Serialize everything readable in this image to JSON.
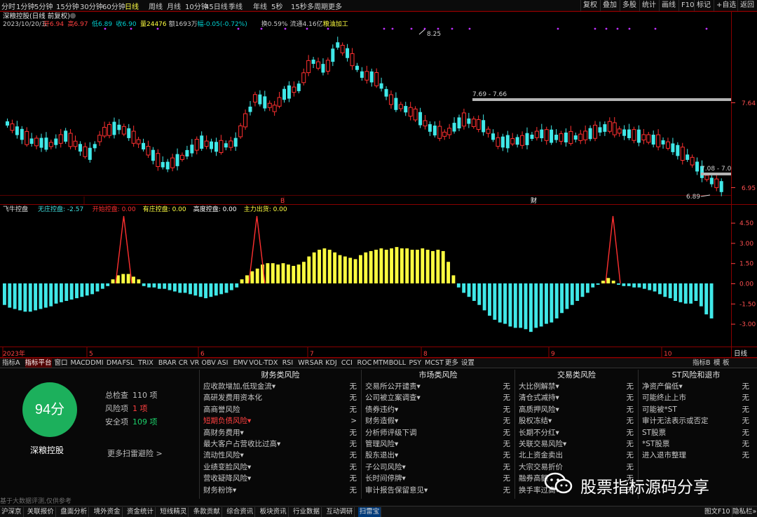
{
  "toolbar": {
    "periods": [
      "分时",
      "1分钟",
      "5分钟",
      "15分钟",
      "30分钟",
      "60分钟",
      "日线",
      "周线",
      "月线",
      "10分钟",
      "45日线",
      "季线",
      "年线",
      "5秒",
      "15秒",
      "多周期",
      "更多"
    ],
    "active_period": "日线",
    "tools": [
      "复权",
      "叠加",
      "多股",
      "统计",
      "画线",
      "F10",
      "标记",
      "+自选",
      "返回"
    ]
  },
  "header": {
    "stock": "深粮控股(日线 前复权)",
    "date": "2023/10/20/五",
    "quote": [
      {
        "label": "开",
        "value": "6.94",
        "color": "#ff4040"
      },
      {
        "label": "高",
        "value": "6.97",
        "color": "#ff4040"
      },
      {
        "label": "低",
        "value": "6.89",
        "color": "#00d0d0"
      },
      {
        "label": "收",
        "value": "6.90",
        "color": "#00d0d0"
      },
      {
        "label": "量",
        "value": "24476",
        "color": "#ffff40"
      },
      {
        "label": "额",
        "value": "1693万",
        "color": "#c8c8c8"
      },
      {
        "label": "幅",
        "value": "-0.05(-0.72%)",
        "color": "#00d0d0"
      },
      {
        "label": "换",
        "value": "0.59%",
        "color": "#c8c8c8"
      },
      {
        "label": "流通",
        "value": "4.16亿",
        "color": "#c8c8c8"
      },
      {
        "label": "",
        "value": "粮油加工",
        "color": "#ffff40"
      }
    ]
  },
  "main_chart": {
    "price_ticks": [
      "7.64",
      "6.95"
    ],
    "annotations": {
      "high": "8.25",
      "resistance": "7.69 - 7.66",
      "support": "7.08 - 7.0",
      "low": "6.89"
    },
    "markers": [
      "B",
      "财"
    ]
  },
  "indicator": {
    "name": "飞牛控盘",
    "items": [
      {
        "label": "无庄控盘",
        "value": "-2.57",
        "color": "#40e0e0"
      },
      {
        "label": "开始控盘",
        "value": "0.00",
        "color": "#ff3030"
      },
      {
        "label": "有庄控盘",
        "value": "0.00",
        "color": "#ffff40"
      },
      {
        "label": "高度控盘",
        "value": "0.00",
        "color": "#ffffff"
      },
      {
        "label": "主力出货",
        "value": "0.00",
        "color": "#ffff40"
      }
    ],
    "ticks": [
      "4.50",
      "3.00",
      "1.50",
      "0.00",
      "-1.50",
      "-3.00"
    ],
    "months": [
      "2023年",
      "5",
      "6",
      "7",
      "8",
      "9",
      "10"
    ],
    "axis_label": "日线"
  },
  "chart_data": {
    "type": "bar",
    "title": "飞牛控盘",
    "ylim": [
      -3.8,
      5.2
    ],
    "x": [
      "2023-04",
      "2023-05",
      "2023-06",
      "2023-07",
      "2023-08",
      "2023-09",
      "2023-10"
    ],
    "values": [
      -1.6,
      -1.8,
      -1.9,
      -2.0,
      -2.1,
      -2.1,
      -2.0,
      -1.9,
      -1.8,
      -1.7,
      -1.5,
      -1.4,
      -1.3,
      -1.2,
      -1.1,
      -1.0,
      -0.9,
      -0.8,
      -0.6,
      -0.4,
      -0.2,
      0.3,
      0.6,
      0.7,
      0.7,
      0.5,
      0.3,
      -0.2,
      -0.3,
      -0.3,
      -0.4,
      -0.4,
      -0.5,
      -0.6,
      -0.7,
      -0.7,
      -0.8,
      -0.9,
      -1.0,
      -1.1,
      -1.0,
      -0.9,
      -0.8,
      -0.7,
      -0.5,
      -0.3,
      0.3,
      0.6,
      0.9,
      1.1,
      1.4,
      1.5,
      1.5,
      1.4,
      1.5,
      1.4,
      1.3,
      1.4,
      1.6,
      2.0,
      2.3,
      2.5,
      2.6,
      2.5,
      2.3,
      2.1,
      2.0,
      1.9,
      1.8,
      2.1,
      2.3,
      2.4,
      2.5,
      2.6,
      2.5,
      2.6,
      2.7,
      2.6,
      2.6,
      2.5,
      2.5,
      2.6,
      2.5,
      2.4,
      2.5,
      2.4,
      1.6,
      0.6,
      -0.3,
      -0.7,
      -1.0,
      -1.3,
      -1.6,
      -2.0,
      -2.4,
      -2.7,
      -2.9,
      -3.0,
      -3.2,
      -3.3,
      -3.3,
      -3.4,
      -3.6,
      -3.3,
      -3.2,
      -3.0,
      -2.9,
      -2.6,
      -2.2,
      -1.9,
      -1.6,
      -1.3,
      -1.0,
      -0.7,
      -0.3,
      -0.1,
      0.2,
      0.4,
      0.2,
      -0.1,
      -0.2,
      -0.2,
      -0.3,
      -0.3,
      -0.4,
      -0.5,
      -0.6,
      -0.8,
      -1.0,
      -1.1,
      -1.3,
      -1.4,
      -1.5,
      -1.5,
      -1.3,
      -1.7,
      -2.3,
      -2.6
    ]
  },
  "tabs": {
    "items": [
      "指标A",
      "指标平台",
      "窗口",
      "MACD",
      "DMI",
      "DMA",
      "FSL",
      "TRIX",
      "BRAR",
      "CR",
      "VR",
      "OBV",
      "ASI",
      "EMV",
      "VOL-TDX",
      "RSI",
      "WR",
      "SAR",
      "KDJ",
      "CCI",
      "ROC",
      "MTM",
      "BOLL",
      "PSY",
      "MCST",
      "更多",
      "设置"
    ],
    "active": "指标平台",
    "right": [
      "指标B",
      "模",
      "板"
    ]
  },
  "scan": {
    "score": "94分",
    "name": "深粮控股",
    "stats": [
      {
        "label": "总检查",
        "value": "110 项",
        "color": "#bdbdbd"
      },
      {
        "label": "风险项",
        "value": "1 项",
        "color": "#ff4040"
      },
      {
        "label": "安全项",
        "value": "109 项",
        "color": "#1cd06a"
      }
    ],
    "more": "更多扫雷避险 >",
    "disclaimer": "基于大数据评测,仅供参考"
  },
  "risk": [
    {
      "title": "财务类风险",
      "items": [
        {
          "label": "应收款增加,低现金流▾",
          "value": "无"
        },
        {
          "label": "高研发费用资本化",
          "value": "无"
        },
        {
          "label": "高商誉风险",
          "value": "无"
        },
        {
          "label": "短期负债风险▾",
          "value": ">",
          "highlight": true
        },
        {
          "label": "高财务费用▾",
          "value": "无"
        },
        {
          "label": "最大客户占营收比过高▾",
          "value": "无"
        },
        {
          "label": "流动性风险▾",
          "value": "无"
        },
        {
          "label": "业绩变脸风险▾",
          "value": "无"
        },
        {
          "label": "营收疑降风险▾",
          "value": "无"
        },
        {
          "label": "财务粉饰▾",
          "value": "无"
        }
      ]
    },
    {
      "title": "市场类风险",
      "items": [
        {
          "label": "交易所公开谴责▾",
          "value": "无"
        },
        {
          "label": "公司被立案调查▾",
          "value": "无"
        },
        {
          "label": "债券违约▾",
          "value": "无"
        },
        {
          "label": "财务造假▾",
          "value": "无"
        },
        {
          "label": "分析师评级下调",
          "value": "无"
        },
        {
          "label": "管理风险▾",
          "value": "无"
        },
        {
          "label": "股东退出▾",
          "value": "无"
        },
        {
          "label": "子公司风险▾",
          "value": "无"
        },
        {
          "label": "长时间停牌▾",
          "value": "无"
        },
        {
          "label": "审计报告保留意见▾",
          "value": "无"
        }
      ]
    },
    {
      "title": "交易类风险",
      "items": [
        {
          "label": "大比例解禁▾",
          "value": "无"
        },
        {
          "label": "清仓式减持▾",
          "value": "无"
        },
        {
          "label": "高质押风险▾",
          "value": "无"
        },
        {
          "label": "股权冻结▾",
          "value": "无"
        },
        {
          "label": "长期不分红▾",
          "value": "无"
        },
        {
          "label": "关联交易风险▾",
          "value": "无"
        },
        {
          "label": "北上资金卖出",
          "value": "无"
        },
        {
          "label": "大宗交易折价",
          "value": "无"
        },
        {
          "label": "融券高额",
          "value": "无"
        },
        {
          "label": "换手率过高▾",
          "value": "无"
        }
      ]
    },
    {
      "title": "ST风险和退市",
      "items": [
        {
          "label": "净资产偏低▾",
          "value": "无"
        },
        {
          "label": "可能终止上市",
          "value": "无"
        },
        {
          "label": "可能被*ST",
          "value": "无"
        },
        {
          "label": "审计无法表示或否定",
          "value": "无"
        },
        {
          "label": "ST股票",
          "value": "无"
        },
        {
          "label": "*ST股票",
          "value": "无"
        },
        {
          "label": "进入退市整理",
          "value": "无"
        }
      ]
    }
  ],
  "watermark": "股票指标源码分享",
  "bottom": {
    "items": [
      "沪深京",
      "关联报价",
      "盘面分析",
      "境外资金",
      "资金统计",
      "短线精灵",
      "条款贡献",
      "综合资讯",
      "板块资讯",
      "行业数据",
      "互动调研",
      "扫雷宝"
    ],
    "active": "扫雷宝",
    "right": [
      "图文F10",
      "隐私栏»"
    ]
  },
  "colors": {
    "up": "#ff3030",
    "down": "#40e8e8",
    "bull": "#ffff40",
    "signal": "#ff3030",
    "grid": "#8a0000"
  }
}
